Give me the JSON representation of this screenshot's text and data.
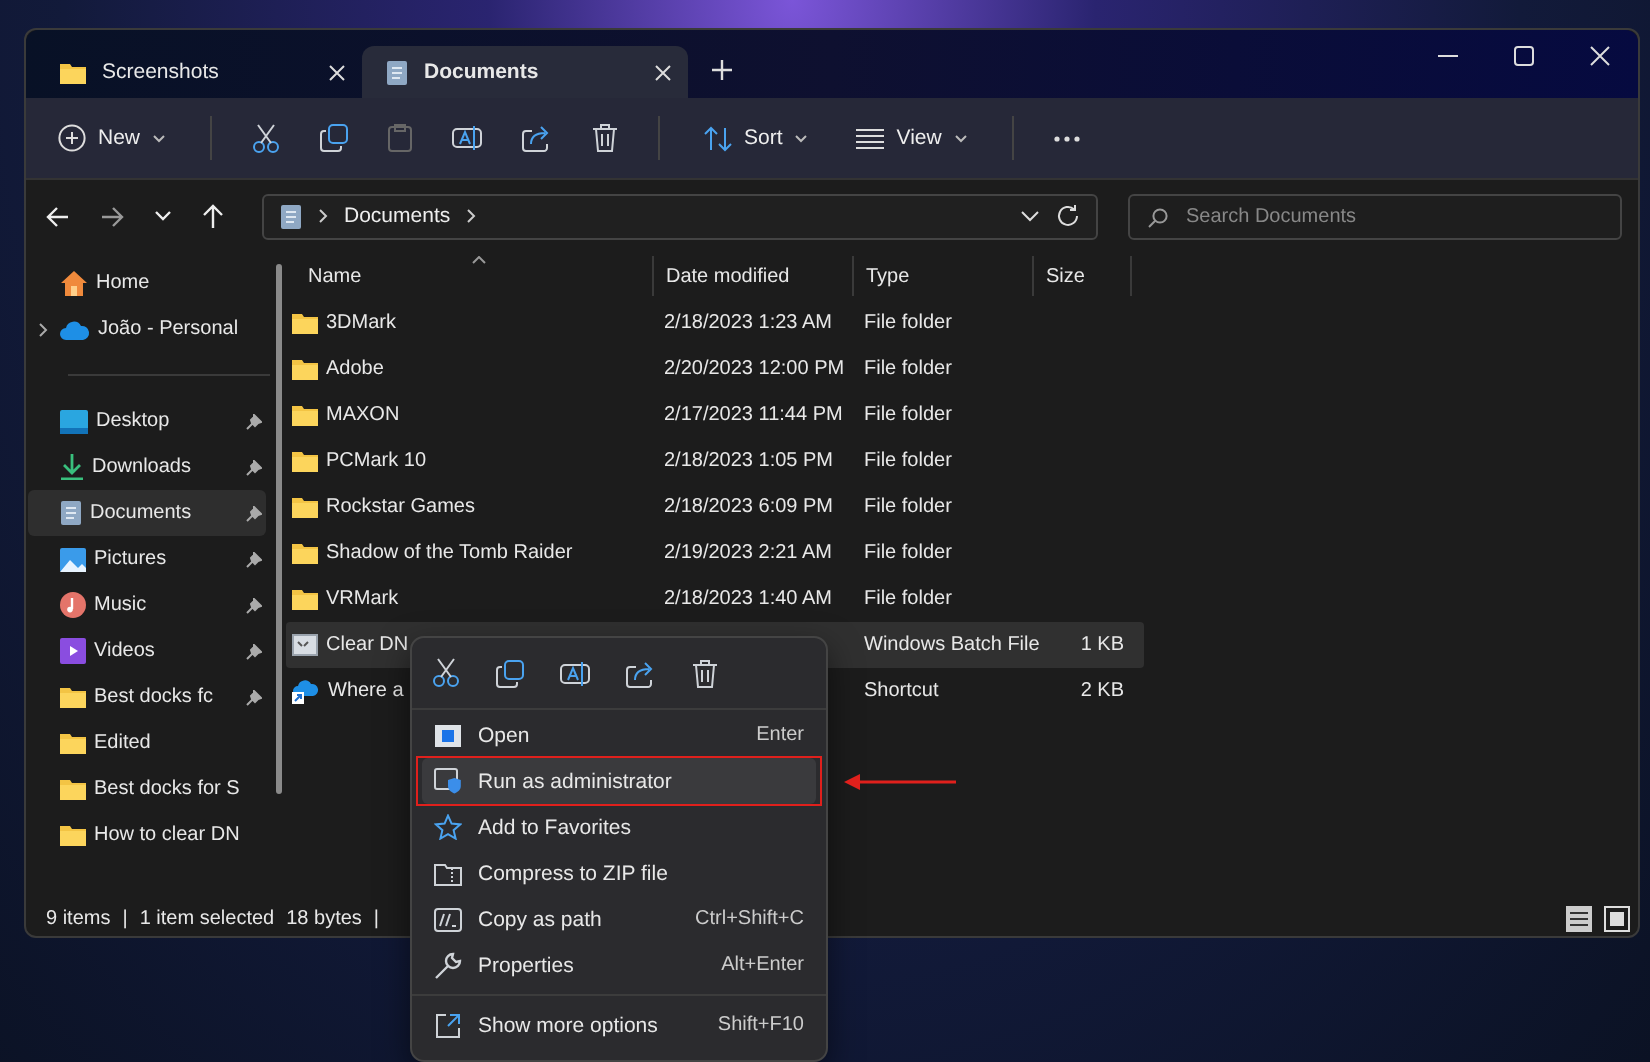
{
  "tabs": [
    {
      "kind": "folder",
      "label": "Screenshots",
      "selected": false
    },
    {
      "kind": "document",
      "label": "Documents",
      "selected": true
    }
  ],
  "toolbar": {
    "new_label": "New",
    "sort_label": "Sort",
    "view_label": "View"
  },
  "address": {
    "crumb": "Documents"
  },
  "search": {
    "placeholder": "Search Documents"
  },
  "sidebar": [
    {
      "items": [
        {
          "kind": "home",
          "label": "Home",
          "expandable": false,
          "pinned": false,
          "selected": false
        },
        {
          "kind": "cloud",
          "label": "João - Personal",
          "expandable": true,
          "pinned": false,
          "selected": false
        }
      ]
    },
    {
      "items": [
        {
          "kind": "desktop",
          "label": "Desktop",
          "expandable": false,
          "pinned": true,
          "selected": false
        },
        {
          "kind": "download",
          "label": "Downloads",
          "expandable": false,
          "pinned": true,
          "selected": false
        },
        {
          "kind": "document",
          "label": "Documents",
          "expandable": false,
          "pinned": true,
          "selected": true
        },
        {
          "kind": "picture",
          "label": "Pictures",
          "expandable": false,
          "pinned": true,
          "selected": false
        },
        {
          "kind": "music",
          "label": "Music",
          "expandable": false,
          "pinned": true,
          "selected": false
        },
        {
          "kind": "video",
          "label": "Videos",
          "expandable": false,
          "pinned": true,
          "selected": false
        },
        {
          "kind": "folder",
          "label": "Best docks fc",
          "expandable": false,
          "pinned": true,
          "selected": false
        },
        {
          "kind": "folder",
          "label": "Edited",
          "expandable": false,
          "pinned": false,
          "selected": false
        },
        {
          "kind": "folder",
          "label": "Best docks for S",
          "expandable": false,
          "pinned": false,
          "selected": false
        },
        {
          "kind": "folder",
          "label": "How to clear DN",
          "expandable": false,
          "pinned": false,
          "selected": false
        }
      ]
    }
  ],
  "table": {
    "columns": [
      "Name",
      "Date modified",
      "Type",
      "Size"
    ],
    "rows": [
      {
        "kind": "folder",
        "name": "3DMark",
        "date": "2/18/2023 1:23 AM",
        "type": "File folder",
        "selected": false
      },
      {
        "kind": "folder",
        "name": "Adobe",
        "date": "2/20/2023 12:00 PM",
        "type": "File folder",
        "selected": false
      },
      {
        "kind": "folder",
        "name": "MAXON",
        "date": "2/17/2023 11:44 PM",
        "type": "File folder",
        "selected": false
      },
      {
        "kind": "folder",
        "name": "PCMark 10",
        "date": "2/18/2023 1:05 PM",
        "type": "File folder",
        "selected": false
      },
      {
        "kind": "folder",
        "name": "Rockstar Games",
        "date": "2/18/2023 6:09 PM",
        "type": "File folder",
        "selected": false
      },
      {
        "kind": "folder",
        "name": "Shadow of the Tomb Raider",
        "date": "2/19/2023 2:21 AM",
        "type": "File folder",
        "selected": false
      },
      {
        "kind": "folder",
        "name": "VRMark",
        "date": "2/18/2023 1:40 AM",
        "type": "File folder",
        "selected": false
      },
      {
        "kind": "batch",
        "name": "Clear DN",
        "type": "Windows Batch File",
        "size": "1 KB",
        "selected": true
      },
      {
        "kind": "shortcut",
        "name": "Where a",
        "type": "Shortcut",
        "size": "2 KB",
        "selected": false
      }
    ]
  },
  "status_bar": [
    "9 items",
    "|",
    "1 item selected",
    "18 bytes",
    "|"
  ],
  "context_menu": {
    "sections": [
      {
        "items": [
          {
            "kind": "open",
            "label": "Open",
            "shortcut": "Enter",
            "highlighted": false,
            "annotated": false
          },
          {
            "kind": "admin",
            "label": "Run as administrator",
            "highlighted": true,
            "annotated": true
          },
          {
            "kind": "star",
            "label": "Add to Favorites",
            "highlighted": false,
            "annotated": false
          },
          {
            "kind": "zip",
            "label": "Compress to ZIP file",
            "highlighted": false,
            "annotated": false
          },
          {
            "kind": "path",
            "label": "Copy as path",
            "shortcut": "Ctrl+Shift+C",
            "highlighted": false,
            "annotated": false
          },
          {
            "kind": "wrench",
            "label": "Properties",
            "shortcut": "Alt+Enter",
            "highlighted": false,
            "annotated": false
          }
        ]
      },
      {
        "items": [
          {
            "kind": "more",
            "label": "Show more options",
            "shortcut": "Shift+F10",
            "highlighted": false,
            "annotated": false
          }
        ]
      }
    ]
  }
}
